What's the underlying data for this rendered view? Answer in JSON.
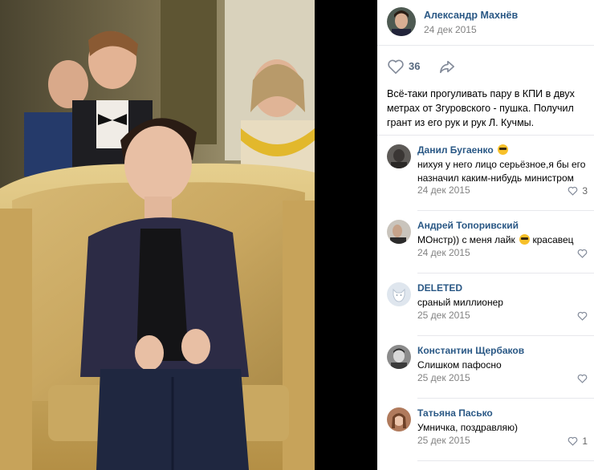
{
  "post": {
    "author_name": "Александр Махнёв",
    "date": "24 дек 2015",
    "likes": "36",
    "caption": "Всё-таки прогуливать пару в КПИ в двух метрах от Згуровского - пушка. Получил грант из его рук и рук Л. Кучмы."
  },
  "comments": [
    {
      "name": "Данил Бугаенко",
      "text": "нихуя у него лицо серьёзное,я бы его назначил каким-нибудь министром",
      "date": "24 дек 2015",
      "likes": "3"
    },
    {
      "name": "Андрей Топоривский",
      "text": "МОнстр)) с меня лайк",
      "text_after": "красавец",
      "date": "24 дек 2015",
      "likes": ""
    },
    {
      "name": "DELETED",
      "text": "сраный миллионер",
      "date": "25 дек 2015",
      "likes": ""
    },
    {
      "name": "Константин Щербаков",
      "text": "Слишком пафосно",
      "date": "25 дек 2015",
      "likes": ""
    },
    {
      "name": "Татьяна Пасько",
      "text": "Умничка, поздравляю)",
      "date": "25 дек 2015",
      "likes": "1"
    }
  ],
  "colors": {
    "link": "#2a5885",
    "muted": "#828282",
    "divider": "#e7e8ec",
    "icon": "#828a99"
  },
  "icons": [
    "heart-icon",
    "share-arrow-icon",
    "sunglasses-emoji-icon",
    "smirk-emoji-icon"
  ]
}
